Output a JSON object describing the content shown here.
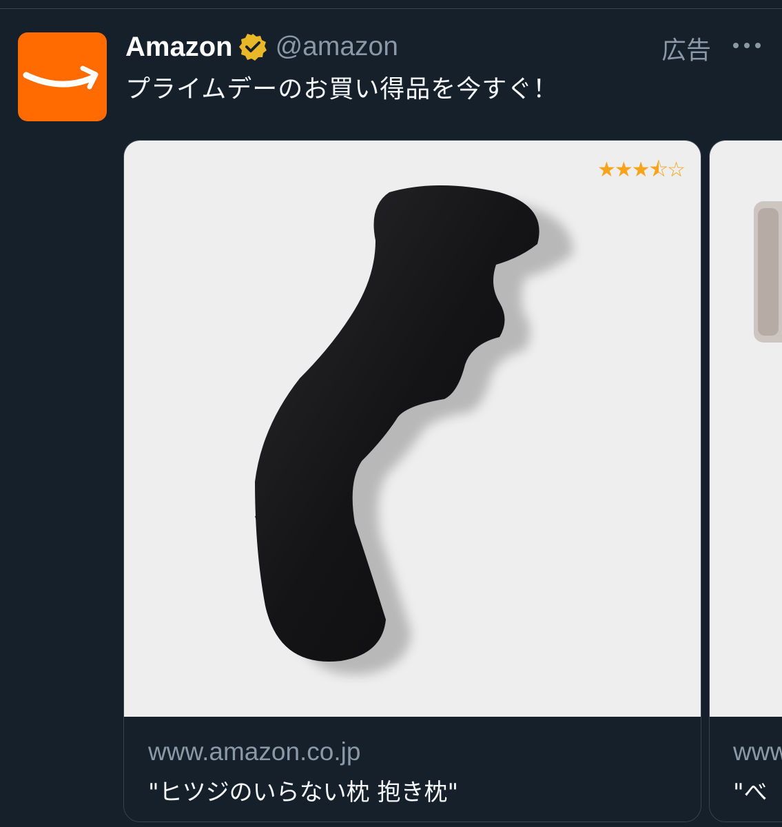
{
  "post": {
    "display_name": "Amazon",
    "handle": "@amazon",
    "ad_label": "広告",
    "text": "プライムデーのお買い得品を今すぐ！"
  },
  "cards": [
    {
      "rating": 3.5,
      "rating_stars": "★★★",
      "rating_half": "⯪",
      "rating_empty": "☆",
      "domain": "www.amazon.co.jp",
      "title": "\"ヒツジのいらない枕 抱き枕\""
    },
    {
      "domain": "www",
      "title": "\"べ"
    }
  ],
  "colors": {
    "background": "#15202b",
    "brand_orange": "#ff6b00",
    "verified_gold": "#e8b828",
    "muted_text": "#8b98a5",
    "star": "#f7a31b"
  },
  "icons": {
    "avatar": "amazon-smile-logo",
    "verified": "verified-badge-icon",
    "more": "more-options-icon"
  }
}
